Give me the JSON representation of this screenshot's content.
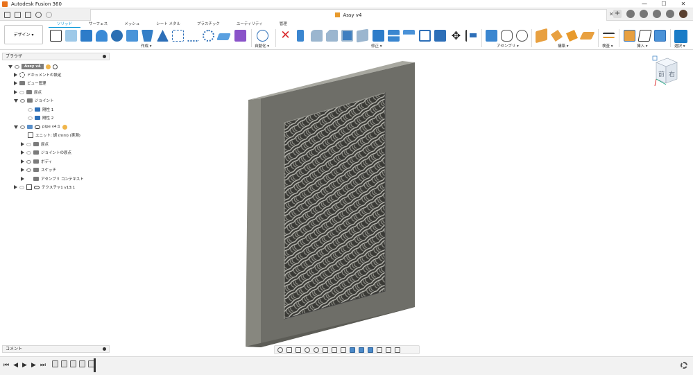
{
  "window": {
    "title": "Autodesk Fusion 360",
    "min": "—",
    "max": "☐",
    "close": "✕"
  },
  "document_tab": {
    "title": "Assy v4",
    "close": "✕"
  },
  "ribbon": {
    "tabs": [
      "ソリッド",
      "サーフェス",
      "メッシュ",
      "シート メタル",
      "プラスチック",
      "ユーティリティ",
      "管理"
    ],
    "workspace": "デザイン ▾",
    "groups": [
      "作成 ▾",
      "自動化 ▾",
      "修正 ▾",
      "アセンブリ ▾",
      "構築 ▾",
      "検査 ▾",
      "挿入 ▾",
      "選択 ▾"
    ]
  },
  "browser": {
    "title": "ブラウザ",
    "root": "Assy v4",
    "items": [
      {
        "label": "ドキュメントの設定"
      },
      {
        "label": "ビュー管理"
      },
      {
        "label": "原点"
      },
      {
        "label": "ジョイント"
      },
      {
        "label": "剛性 1"
      },
      {
        "label": "剛性 2"
      },
      {
        "label": "pipe v4:1"
      },
      {
        "label": "ユニット: 調 (mm) (実測)"
      },
      {
        "label": "原点"
      },
      {
        "label": "ジョイントの原点"
      },
      {
        "label": "ボディ"
      },
      {
        "label": "スケッチ"
      },
      {
        "label": "アセンブリ コンテキスト"
      },
      {
        "label": "テクスチャ1 v13:1"
      }
    ]
  },
  "comments": {
    "label": "コメント"
  },
  "viewcube": {
    "front": "前",
    "right": "右"
  },
  "colors": {
    "accent": "#0696d7",
    "brand": "#e8721c",
    "model": "#6e6e68"
  }
}
